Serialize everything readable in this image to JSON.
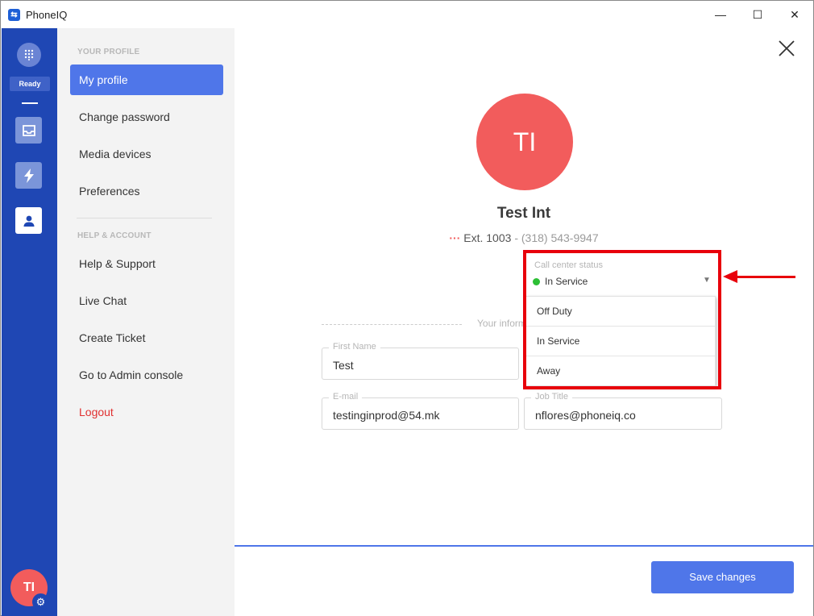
{
  "window": {
    "title": "PhoneIQ",
    "app_icon_glyph": "⇆",
    "minimize": "—",
    "maximize": "☐",
    "close": "✕"
  },
  "rail": {
    "status": "Ready",
    "avatar_initials": "TI"
  },
  "sidebar": {
    "profile_section_title": "YOUR PROFILE",
    "profile_items": [
      "My profile",
      "Change password",
      "Media devices",
      "Preferences"
    ],
    "help_section_title": "HELP & ACCOUNT",
    "help_items": [
      "Help & Support",
      "Live Chat",
      "Create Ticket",
      "Go to Admin console"
    ],
    "logout": "Logout"
  },
  "profile": {
    "initials": "TI",
    "name": "Test Int",
    "ext": "Ext. 1003",
    "separator": "-",
    "phone": "(318) 543-9947",
    "call_center_status": {
      "label": "Call center status",
      "value": "In Service",
      "status_color": "#2cbf35",
      "options": [
        "Off Duty",
        "In Service",
        "Away"
      ]
    },
    "info_section_title": "Your inform",
    "fields": {
      "first_name": {
        "label": "First Name",
        "value": "Test"
      },
      "email": {
        "label": "E-mail",
        "value": "testinginprod@54.mk"
      },
      "job_title": {
        "label": "Job Title",
        "value": "nflores@phoneiq.co"
      }
    }
  },
  "actions": {
    "save": "Save changes"
  },
  "colors": {
    "rail": "#1f47b4",
    "accent": "#4f76e9",
    "avatar": "#f25c5c",
    "annotation": "#e8000b"
  }
}
